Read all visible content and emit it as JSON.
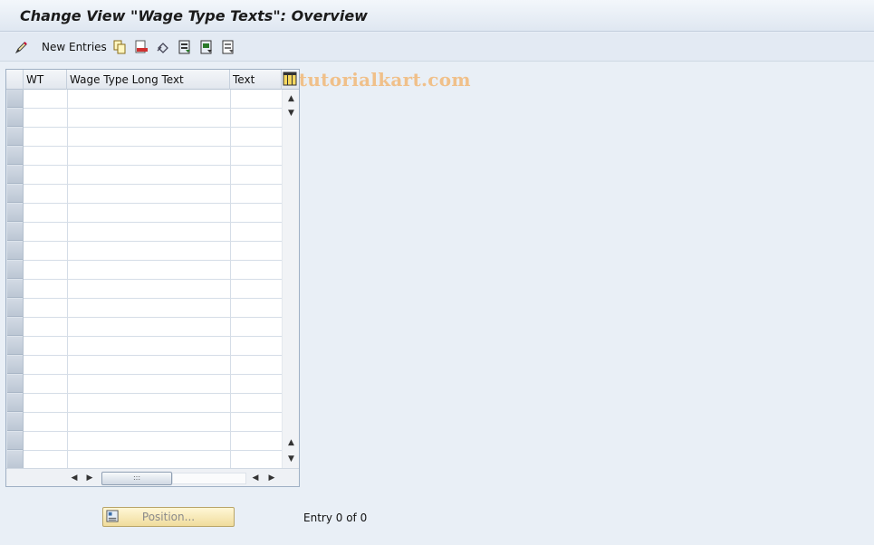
{
  "header": {
    "title": "Change View \"Wage Type Texts\": Overview"
  },
  "toolbar": {
    "new_entries_label": "New Entries",
    "icons": [
      "display-change-icon",
      "copy-icon",
      "delete-icon",
      "undo-icon",
      "select-all-icon",
      "select-block-icon",
      "deselect-all-icon"
    ]
  },
  "watermark": "www.tutorialkart.com",
  "table": {
    "columns": [
      "WT",
      "Wage Type Long Text",
      "Text"
    ],
    "rows": []
  },
  "footer": {
    "position_label": "Position...",
    "entry_text": "Entry 0 of 0"
  }
}
